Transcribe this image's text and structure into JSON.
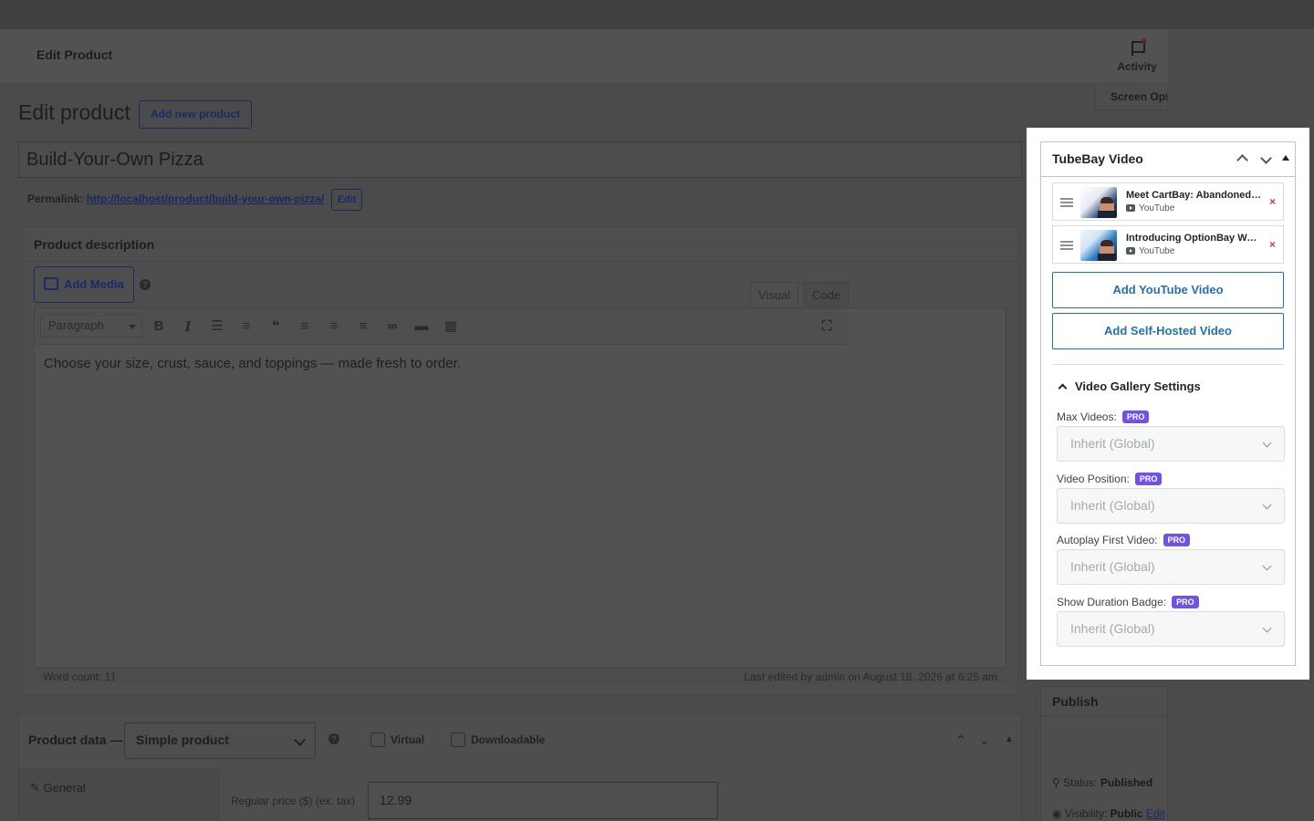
{
  "header": {
    "title": "Edit Product",
    "activity_label": "Activity",
    "screen_options_label": "Screen Options"
  },
  "page": {
    "title": "Edit product",
    "add_new_label": "Add new product"
  },
  "product": {
    "title": "Build-Your-Own Pizza",
    "permalink_label": "Permalink:",
    "permalink_url": "http://localhost/product/build-your-own-pizza/",
    "permalink_edit": "Edit"
  },
  "description": {
    "header": "Product description",
    "add_media": "Add Media",
    "tab_visual": "Visual",
    "tab_code": "Code",
    "format": "Paragraph",
    "content": "Choose your size, crust, sauce, and toppings — made fresh to order.",
    "word_count": "Word count: 11",
    "last_edited": "Last edited by admin on August 18, 2026 at 6:25 am"
  },
  "product_data": {
    "title": "Product data —",
    "type": "Simple product",
    "virtual_label": "Virtual",
    "downloadable_label": "Downloadable",
    "tab_general": "General",
    "regular_price_label": "Regular price ($) (ex. tax)",
    "regular_price": "12.99"
  },
  "publish": {
    "header": "Publish",
    "status_label": "Status:",
    "status_value": "Published",
    "visibility_label": "Visibility:",
    "visibility_value": "Public",
    "visibility_edit": "Edit"
  },
  "tubebay": {
    "title": "TubeBay Video",
    "videos": [
      {
        "title": "Meet CartBay: Abandoned Cart Recovery",
        "source": "YouTube"
      },
      {
        "title": "Introducing OptionBay WooCommerce",
        "source": "YouTube"
      }
    ],
    "add_youtube": "Add YouTube Video",
    "add_self_hosted": "Add Self-Hosted Video",
    "settings_title": "Video Gallery Settings",
    "pro_badge": "PRO",
    "fields": [
      {
        "label": "Max Videos:",
        "value": "Inherit (Global)"
      },
      {
        "label": "Video Position:",
        "value": "Inherit (Global)"
      },
      {
        "label": "Autoplay First Video:",
        "value": "Inherit (Global)"
      },
      {
        "label": "Show Duration Badge:",
        "value": "Inherit (Global)"
      }
    ]
  }
}
